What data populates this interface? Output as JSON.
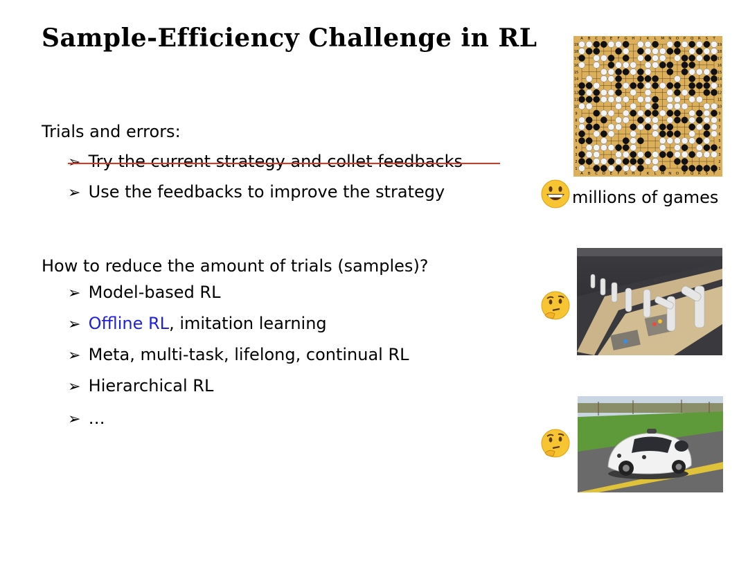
{
  "title": "Sample-Efficiency Challenge in RL",
  "section1": {
    "heading": "Trials and errors:",
    "bullets": [
      "Try the current strategy and collet feedbacks",
      "Use the feedbacks to improve the strategy"
    ]
  },
  "section2": {
    "heading": "How to reduce the amount of trials (samples)?",
    "bullets": [
      {
        "highlight": "",
        "rest": "Model-based RL"
      },
      {
        "highlight": "Offline RL",
        "rest": ", imitation learning"
      },
      {
        "highlight": "",
        "rest": "Meta, multi-task, lifelong, continual RL"
      },
      {
        "highlight": "",
        "rest": "Hierarchical RL"
      },
      {
        "highlight": "",
        "rest": "…"
      }
    ]
  },
  "go_board": {
    "columns": "A B C D E F G H J K L M N O P Q R S T",
    "row_labels": [
      "19",
      "18",
      "17",
      "16",
      "15",
      "14",
      "13",
      "12",
      "11",
      "10",
      "9",
      "8",
      "7",
      "6",
      "5",
      "4",
      "3",
      "2",
      "1"
    ]
  },
  "caption": "millions of games",
  "colors": {
    "strike": "#e0321e",
    "highlight": "#1f1fe0",
    "board": "#dcb05a",
    "emoji": "#f7c531"
  },
  "icons": {
    "smile": "grinning-face-icon",
    "think": "thinking-face-icon",
    "bullet": "arrowhead-bullet-icon"
  }
}
